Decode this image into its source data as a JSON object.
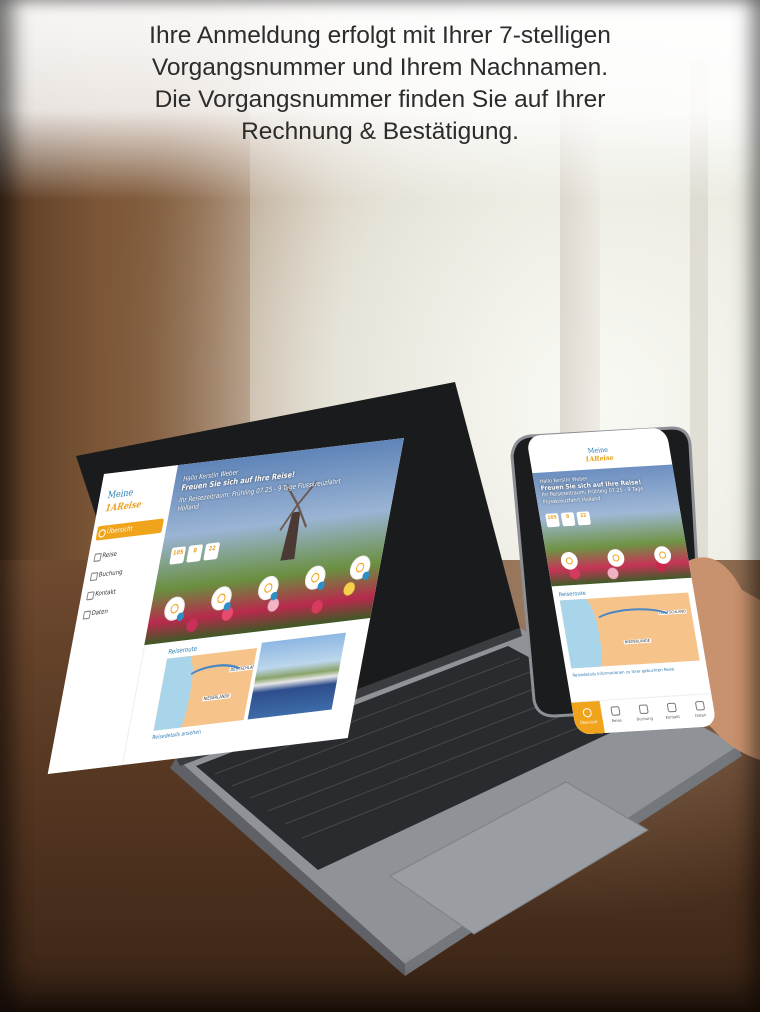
{
  "headline": {
    "line1": "Ihre Anmeldung erfolgt mit Ihrer 7-stelligen",
    "line2": "Vorgangsnummer und Ihrem Nachnamen.",
    "line3": "Die Vorgangsnummer finden Sie auf Ihrer",
    "line4": "Rechnung & Bestätigung."
  },
  "laptop_app": {
    "logo_top": "Meine",
    "logo_bottom": "1AReise",
    "nav": [
      {
        "label": "Übersicht",
        "icon": "home-icon",
        "active": true
      },
      {
        "label": "Reise",
        "icon": "clock-icon",
        "active": false
      },
      {
        "label": "Buchung",
        "icon": "booking-icon",
        "active": false
      },
      {
        "label": "Kontakt",
        "icon": "chat-icon",
        "active": false
      },
      {
        "label": "Daten",
        "icon": "user-icon",
        "active": false
      }
    ],
    "hero_greeting": "Hallo Kerstin Weber",
    "hero_subtitle": "Freuen Sie sich auf Ihre Reise!",
    "hero_trip": "Ihr Reisezeitraum: Frühling 07.25 - 9 Tage Flusskreuzfahrt Holland",
    "countdown": [
      {
        "value": "105",
        "unit": "Tage"
      },
      {
        "value": "8",
        "unit": "Std."
      },
      {
        "value": "22",
        "unit": "Min."
      }
    ],
    "route_title": "Reiseroute",
    "map_label_1": "NIEDERLANDE",
    "map_label_2": "DEUTSCHLAND",
    "details_link": "Reisedetails ansehen"
  },
  "phone_app": {
    "logo_top": "Meine",
    "logo_bottom": "1AReise",
    "hero_greeting": "Hallo Kerstin Weber",
    "hero_subtitle": "Freuen Sie sich auf Ihre Reise!",
    "hero_trip": "Ihr Reisezeitraum: Frühling 07.25 - 9 Tage Flusskreuzfahrt Holland",
    "countdown": [
      {
        "value": "105",
        "unit": "Tage"
      },
      {
        "value": "8",
        "unit": "Std."
      },
      {
        "value": "22",
        "unit": "Min."
      }
    ],
    "route_title": "Reiseroute",
    "map_label_1": "NIEDERLANDE",
    "map_label_2": "DEUTSCHLAND",
    "info_text": "Reisedetails Informationen zu Ihrer gebuchten Reise",
    "tabs": [
      {
        "label": "Übersicht",
        "icon": "home-icon",
        "active": true
      },
      {
        "label": "Reise",
        "icon": "clock-icon",
        "active": false
      },
      {
        "label": "Buchung",
        "icon": "booking-icon",
        "active": false
      },
      {
        "label": "Kontakt",
        "icon": "chat-icon",
        "active": false
      },
      {
        "label": "Daten",
        "icon": "user-icon",
        "active": false
      }
    ]
  },
  "colors": {
    "accent": "#f0a41b",
    "brand_blue": "#2e7bb0"
  }
}
